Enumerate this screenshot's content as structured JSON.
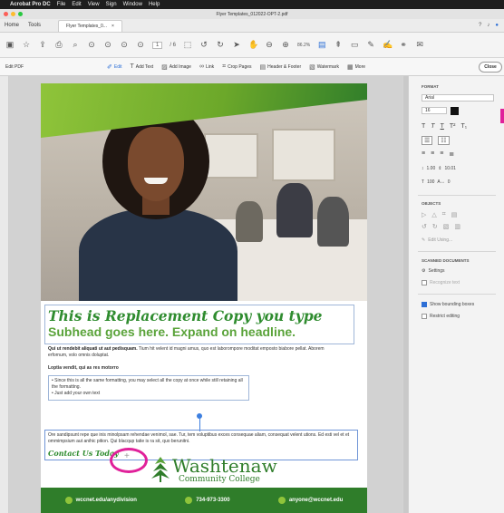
{
  "menubar": {
    "app": "Acrobat Pro DC",
    "items": [
      "File",
      "Edit",
      "View",
      "Sign",
      "Window",
      "Help"
    ]
  },
  "window": {
    "title": "Flyer Templates_012022-OPT-2.pdf"
  },
  "tabs": {
    "home": "Home",
    "tools": "Tools",
    "doc": "Flyer Templates_0...",
    "close": "×"
  },
  "toolbar": {
    "page_current": "1",
    "page_total": "/ 6",
    "zoom": "86.2%"
  },
  "editbar": {
    "label": "Edit PDF",
    "items": [
      "Edit",
      "Add Text",
      "Add Image",
      "Link",
      "Crop Pages",
      "Header & Footer",
      "Watermark",
      "More"
    ],
    "close": "Close"
  },
  "flyer": {
    "headline": "This is Replacement Copy you type",
    "subhead": "Subhead goes here. Expand on headline.",
    "body1_bold": "Qui ut rendebit aliquati ut aut pedisquam.",
    "body1": " Tium hit velent id magni amus, quo est laborompore moditat emposto biabore pellat. Aborem erfornum, volo omnis doluptat.",
    "lopt": "Loptia vendit, qui as res motorro",
    "bullets": [
      "Since this is all the same formatting, you may select all the copy at once while still retaining all the formatting.",
      "Just add your own text"
    ],
    "body2": "Ore sandipsunt repe que inis minolpsam rehendae venimol, sae. Tur, tem voluptibus exces consequae aliam, consequat velent utions. Ed esti vel et et ommimpsium aut anihic pition. Qui blacqup tatie is ra sit, quo berunitni.",
    "contact": "Contact Us Today",
    "cursor": "+",
    "logo_name": "Washtenaw",
    "logo_sub": "Community College",
    "footer": {
      "web": "wccnet.edu/anydivision",
      "phone": "734-973-3300",
      "email": "anyone@wccnet.edu"
    }
  },
  "panel": {
    "format_title": "FORMAT",
    "font": "Arial",
    "size": "16",
    "line_spacing": "1.00",
    "para_spacing": "10.01",
    "scale": "100",
    "char_spacing": "0",
    "objects_title": "OBJECTS",
    "edit_using": "Edit Using...",
    "scanned_title": "SCANNED DOCUMENTS",
    "settings": "Settings",
    "recognize": "Recognize text",
    "show_boxes": "Show bounding boxes",
    "restrict": "Restrict editing"
  },
  "colors": {
    "green_dark": "#2f7d2a",
    "green_light": "#8fc43a",
    "headline_green": "#2f8c2f",
    "cursor_ring": "#e0219a",
    "accent_blue": "#2d6fd6"
  }
}
